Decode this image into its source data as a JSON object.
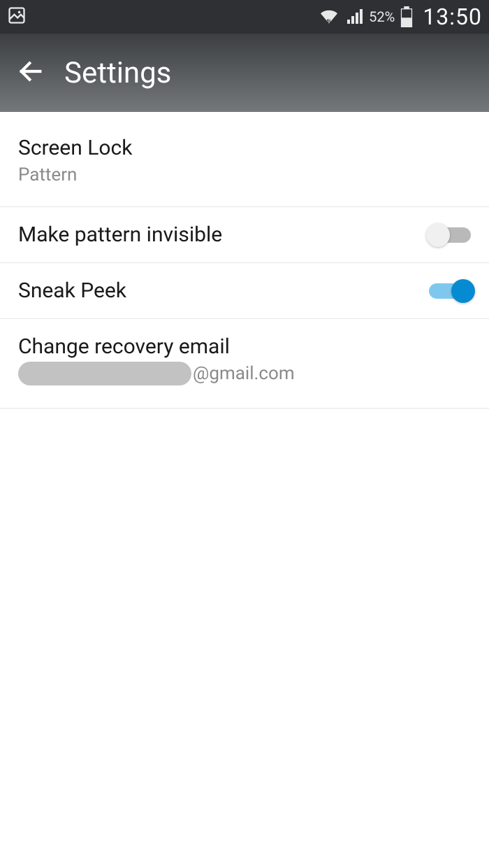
{
  "status": {
    "battery_pct": "52%",
    "time": "13:50"
  },
  "appbar": {
    "title": "Settings"
  },
  "rows": {
    "screen_lock": {
      "label": "Screen Lock",
      "sub": "Pattern"
    },
    "make_invisible": {
      "label": "Make pattern invisible"
    },
    "sneak_peek": {
      "label": "Sneak Peek"
    },
    "recovery": {
      "label": "Change recovery email",
      "suffix": "@gmail.com"
    }
  }
}
